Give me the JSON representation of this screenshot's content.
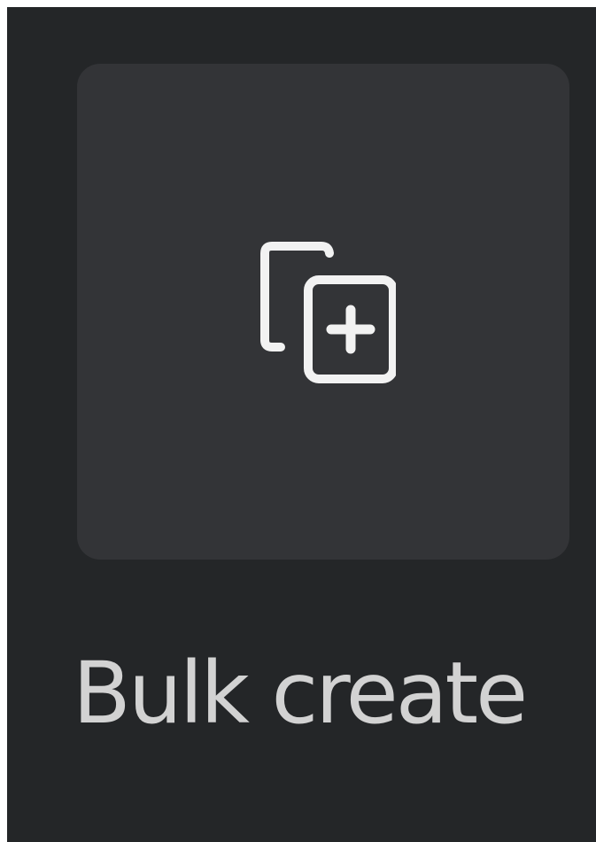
{
  "app": {
    "tool": {
      "icon": "duplicate-plus-icon",
      "label": "Bulk create"
    }
  },
  "colors": {
    "background": "#242628",
    "tile": "#333437",
    "icon": "#f2f2f2",
    "label": "#d2d2d2"
  }
}
